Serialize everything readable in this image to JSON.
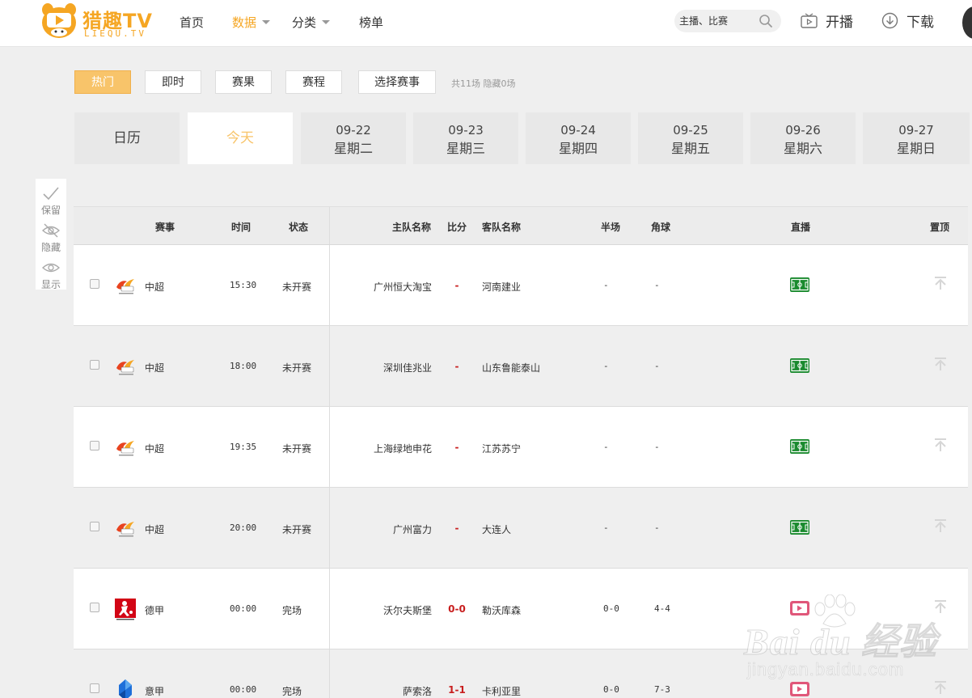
{
  "header": {
    "logo": {
      "cn": "猎趣TV",
      "en": "LIEQU.TV"
    },
    "nav": [
      {
        "label": "首页",
        "active": false,
        "caret": false
      },
      {
        "label": "数据",
        "active": true,
        "caret": true
      },
      {
        "label": "分类",
        "active": false,
        "caret": true
      },
      {
        "label": "榜单",
        "active": false,
        "caret": false
      }
    ],
    "search": {
      "placeholder": "主播、比赛"
    },
    "broadcast_label": "开播",
    "download_label": "下载"
  },
  "filters": {
    "buttons": [
      "热门",
      "即时",
      "赛果",
      "赛程",
      "选择赛事"
    ],
    "active": "热门",
    "count_text": "共11场 隐藏0场"
  },
  "dates": [
    {
      "label": "日历"
    },
    {
      "label": "今天",
      "today": true
    },
    {
      "date": "09-22",
      "weekday": "星期二"
    },
    {
      "date": "09-23",
      "weekday": "星期三"
    },
    {
      "date": "09-24",
      "weekday": "星期四"
    },
    {
      "date": "09-25",
      "weekday": "星期五"
    },
    {
      "date": "09-26",
      "weekday": "星期六"
    },
    {
      "date": "09-27",
      "weekday": "星期日"
    }
  ],
  "side_tools": [
    {
      "label": "保留",
      "icon": "check-icon"
    },
    {
      "label": "隐藏",
      "icon": "eye-off-icon"
    },
    {
      "label": "显示",
      "icon": "eye-icon"
    }
  ],
  "table": {
    "headers": {
      "league": "赛事",
      "time": "时间",
      "status": "状态",
      "home": "主队名称",
      "score": "比分",
      "away": "客队名称",
      "half": "半场",
      "corners": "角球",
      "live": "直播",
      "pin": "置顶"
    },
    "rows": [
      {
        "league": "中超",
        "league_logo": "csl-logo",
        "time": "15:30",
        "status": "未开赛",
        "home": "广州恒大淘宝",
        "score": "-",
        "away": "河南建业",
        "half": "-",
        "corners": "-",
        "live_icon": "field-icon"
      },
      {
        "league": "中超",
        "league_logo": "csl-logo",
        "time": "18:00",
        "status": "未开赛",
        "home": "深圳佳兆业",
        "score": "-",
        "away": "山东鲁能泰山",
        "half": "-",
        "corners": "-",
        "live_icon": "field-icon"
      },
      {
        "league": "中超",
        "league_logo": "csl-logo",
        "time": "19:35",
        "status": "未开赛",
        "home": "上海绿地申花",
        "score": "-",
        "away": "江苏苏宁",
        "half": "-",
        "corners": "-",
        "live_icon": "field-icon"
      },
      {
        "league": "中超",
        "league_logo": "csl-logo",
        "time": "20:00",
        "status": "未开赛",
        "home": "广州富力",
        "score": "-",
        "away": "大连人",
        "half": "-",
        "corners": "-",
        "live_icon": "field-icon"
      },
      {
        "league": "德甲",
        "league_logo": "bundesliga-logo",
        "time": "00:00",
        "status": "完场",
        "home": "沃尔夫斯堡",
        "score": "0-0",
        "away": "勒沃库森",
        "half": "0-0",
        "corners": "4-4",
        "live_icon": "video-icon"
      },
      {
        "league": "意甲",
        "league_logo": "serie-a-logo",
        "time": "00:00",
        "status": "完场",
        "home": "萨索洛",
        "score": "1-1",
        "away": "卡利亚里",
        "half": "0-0",
        "corners": "7-3",
        "live_icon": "video-icon"
      }
    ]
  },
  "watermark": {
    "top": "Bai du 经验",
    "bottom": "jingyan.baidu.com"
  },
  "colors": {
    "accent": "#f5a623",
    "active_button": "#f8c46a",
    "score": "#c81e1e",
    "live_green": "#1a8a2e",
    "video_pink": "#e0577a"
  }
}
